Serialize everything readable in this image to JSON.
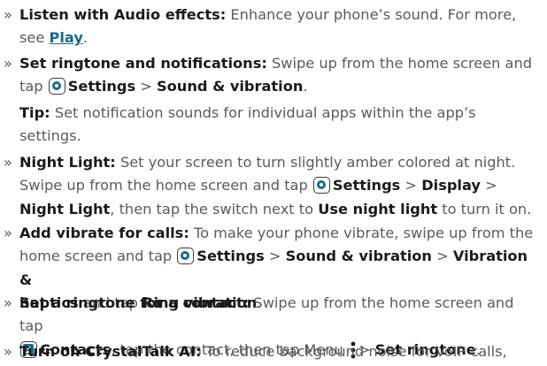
{
  "bullet": "»",
  "items": [
    {
      "title": "Listen with Audio effects:",
      "t1": "Enhance your phone’s sound. For more,",
      "t2": "see",
      "link": "Play",
      "t3": "."
    },
    {
      "title": "Set ringtone and notifications:",
      "t1": "Swipe up from the home screen and",
      "t2": "tap",
      "settings": "Settings",
      "sep": ">",
      "sound": "Sound & vibration",
      "end": "."
    },
    {
      "tip": "Tip:",
      "t1": "Set notification sounds for individual apps within the app’s",
      "t2": "settings."
    },
    {
      "title": "Night Light:",
      "t1": "Set your screen to turn slightly amber colored at night.",
      "t2": "Swipe up from the home screen and tap",
      "settings": "Settings",
      "sep1": ">",
      "display": "Display",
      "sep2": ">",
      "nightlight": "Night Light",
      "t3": ", then tap the switch next to",
      "use": "Use night light",
      "t4": "to turn it on."
    },
    {
      "title": "Add vibrate for calls:",
      "t1": "To make your phone vibrate, swipe up from the",
      "t2": "home screen and tap",
      "settings": "Settings",
      "sep1": ">",
      "sound": "Sound & vibration",
      "sep2": ">",
      "vib": "Vibration &",
      "haptics": "haptics",
      "and": "and tap",
      "ring": "Ring vibration",
      "end": "."
    },
    {
      "title": "Set a ringtone for a contact:",
      "t1": "Swipe up from the home screen and tap",
      "contacts": "Contacts",
      "t2": ", tap the contact, then tap Menu",
      "sep": ">",
      "setring": "Set ringtone",
      "end": "."
    },
    {
      "title": "Turn on CrystalTalk AI:",
      "t1": "To reduce background noise for VoIP calls,"
    }
  ],
  "icons": {
    "settings": "settings-gear-icon",
    "contacts": "contacts-person-icon",
    "menu": "menu-dots-icon"
  },
  "colors": {
    "text": "#5a5a5a",
    "bold": "#1a1a1a",
    "link": "#1a6a8a",
    "icon_fill": "#1a6a8a"
  }
}
